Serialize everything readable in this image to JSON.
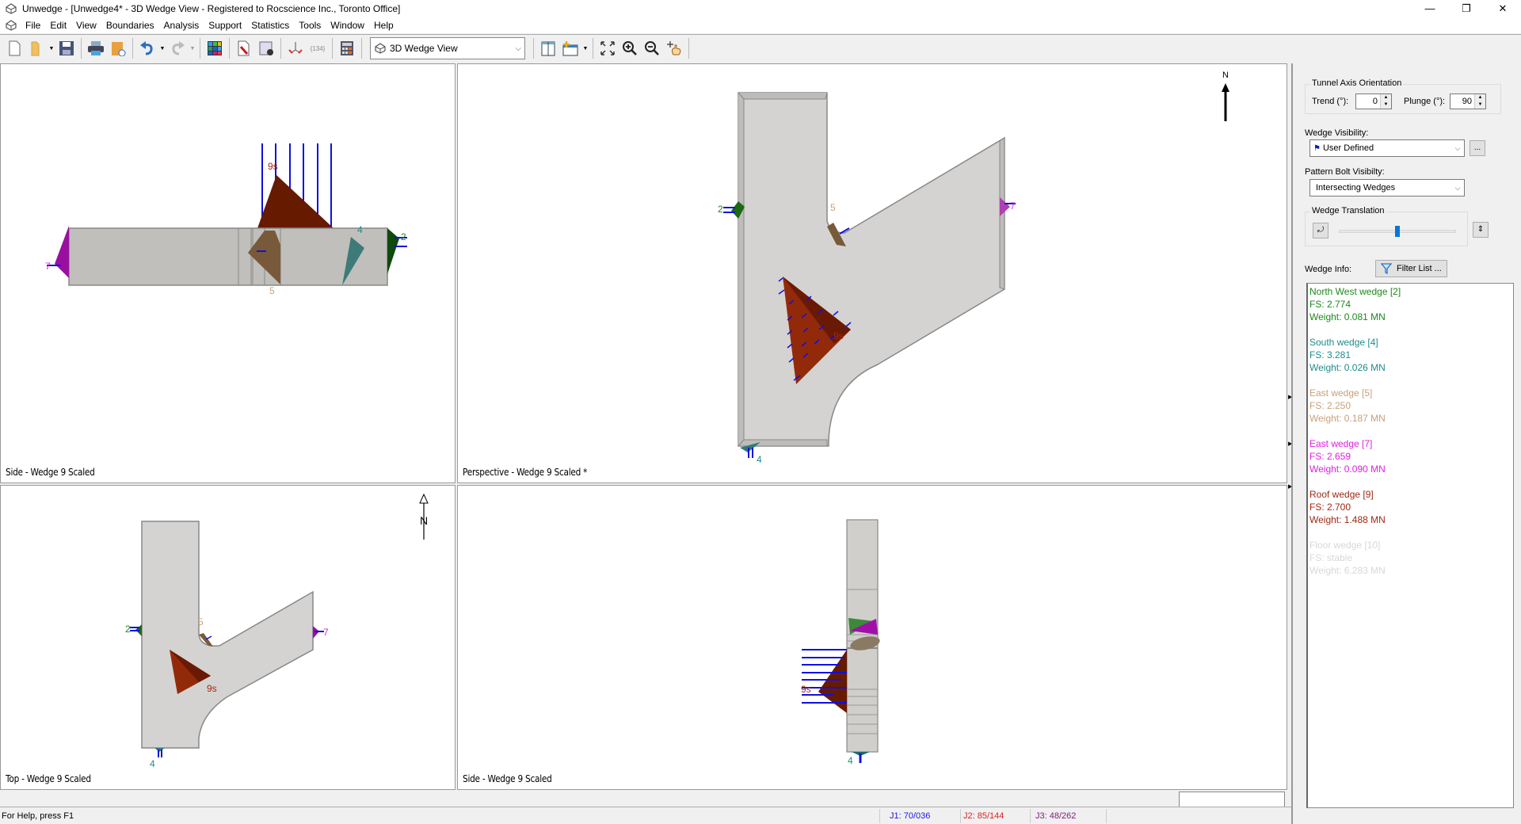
{
  "window": {
    "title": "Unwedge - [Unwedge4* - 3D Wedge View - Registered to Rocscience Inc., Toronto Office]",
    "controls": {
      "minimize": "—",
      "restore": "❐",
      "close": "✕"
    }
  },
  "menu": [
    "File",
    "Edit",
    "View",
    "Boundaries",
    "Analysis",
    "Support",
    "Statistics",
    "Tools",
    "Window",
    "Help"
  ],
  "mdi_controls": {
    "minimize": "_",
    "restore": "🗗",
    "close": "✖"
  },
  "toolbar": {
    "view_select": "3D Wedge View",
    "icons": [
      "new-file-icon",
      "open-folder-icon",
      "save-icon",
      "print-icon",
      "export-icon",
      "undo-icon",
      "redo-icon",
      "color-grid-icon",
      "project-settings-icon",
      "analysis-settings-icon",
      "input-data-icon",
      "joint-combinations-icon",
      "calculator-icon",
      "tile-vertical-icon",
      "new-window-icon",
      "zoom-extents-icon",
      "zoom-in-icon",
      "zoom-out-icon",
      "pan-icon"
    ],
    "joint_combo_text": "{134}"
  },
  "viewports": [
    {
      "label": "Side - Wedge 9 Scaled"
    },
    {
      "label": "Perspective - Wedge 9 Scaled *",
      "north": "N"
    },
    {
      "label": "Top - Wedge 9 Scaled",
      "north": "N"
    },
    {
      "label": "Side - Wedge 9 Scaled"
    }
  ],
  "wedge_labels": {
    "w2": "2",
    "w4": "4",
    "w5": "5",
    "w7": "7",
    "w9": "9s"
  },
  "panel": {
    "tunnel_axis": {
      "title": "Tunnel Axis Orientation",
      "trend_label": "Trend (°):",
      "trend_value": "0",
      "plunge_label": "Plunge (°):",
      "plunge_value": "90"
    },
    "wedge_visibility": {
      "label": "Wedge Visibility:",
      "value": "User Defined",
      "more_button": "..."
    },
    "pattern_bolt_visibility": {
      "label": "Pattern Bolt Visibilty:",
      "value": "Intersecting Wedges"
    },
    "wedge_translation": {
      "title": "Wedge Translation",
      "position": 0.5
    },
    "wedge_info": {
      "label": "Wedge Info:",
      "filter_button": "Filter List ...",
      "entries": [
        {
          "name": "North West wedge [2]",
          "fs": "FS: 2.774",
          "weight": "Weight: 0.081 MN",
          "color": "#1a8a1a"
        },
        {
          "name": "South wedge [4]",
          "fs": "FS: 3.281",
          "weight": "Weight: 0.026 MN",
          "color": "#1f8c8c"
        },
        {
          "name": "East wedge [5]",
          "fs": "FS: 2.250",
          "weight": "Weight: 0.187 MN",
          "color": "#c8a07a"
        },
        {
          "name": "East wedge [7]",
          "fs": "FS: 2.659",
          "weight": "Weight: 0.090 MN",
          "color": "#e020e0"
        },
        {
          "name": "Roof wedge [9]",
          "fs": "FS: 2.700",
          "weight": "Weight: 1.488 MN",
          "color": "#a02810"
        },
        {
          "name": "Floor wedge [10]",
          "fs": "FS: stable",
          "weight": "Weight: 6.283 MN",
          "color": "#d8d8d8"
        }
      ]
    }
  },
  "statusbar": {
    "help": "For Help, press F1",
    "j1": "J1: 70/036",
    "j2": "J2: 85/144",
    "j3": "J3: 48/262",
    "j1_color": "#1a1ae0",
    "j2_color": "#e02020",
    "j3_color": "#802080"
  }
}
